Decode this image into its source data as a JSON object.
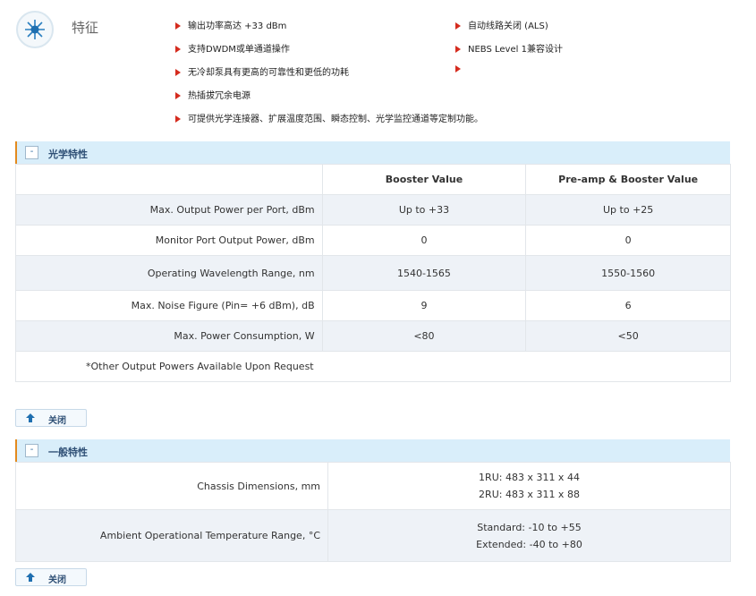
{
  "features": {
    "title": "特征",
    "bullets_left": [
      "输出功率高达 +33 dBm",
      "支持DWDM或单通道操作",
      "无冷却泵具有更高的可靠性和更低的功耗",
      "热插拔冗余电源",
      "可提供光学连接器、扩展温度范围、瞬态控制、光学监控通道等定制功能。"
    ],
    "bullets_right": [
      "自动线路关闭 (ALS)",
      "NEBS Level 1兼容设计",
      ""
    ]
  },
  "optical": {
    "section_toggle": "-",
    "section_title": "光学特性",
    "headers": [
      "",
      "Booster Value",
      "Pre-amp & Booster Value"
    ],
    "rows": [
      {
        "label": "Max. Output Power per Port, dBm",
        "booster": "Up to +33",
        "preamp": "Up to +25"
      },
      {
        "label": "Monitor Port Output Power, dBm",
        "booster": "0",
        "preamp": "0"
      },
      {
        "label": "Operating Wavelength Range, nm",
        "booster": "1540-1565",
        "preamp": "1550-1560"
      },
      {
        "label": "Max. Noise Figure (Pin= +6 dBm), dB",
        "booster": "9",
        "preamp": "6"
      },
      {
        "label": "Max. Power Consumption, W",
        "booster": "<80",
        "preamp": "<50"
      }
    ],
    "note": "*Other Output Powers Available Upon Request",
    "close_label": "关闭"
  },
  "general": {
    "section_toggle": "-",
    "section_title": "一般特性",
    "rows": [
      {
        "label": "Chassis Dimensions, mm",
        "line1": "1RU: 483 x 311 x 44",
        "line2": "2RU: 483 x 311 x 88"
      },
      {
        "label": "Ambient Operational Temperature Range, °C",
        "line1": "Standard: -10 to +55",
        "line2": "Extended: -40 to +80"
      }
    ],
    "close_label": "关闭"
  }
}
